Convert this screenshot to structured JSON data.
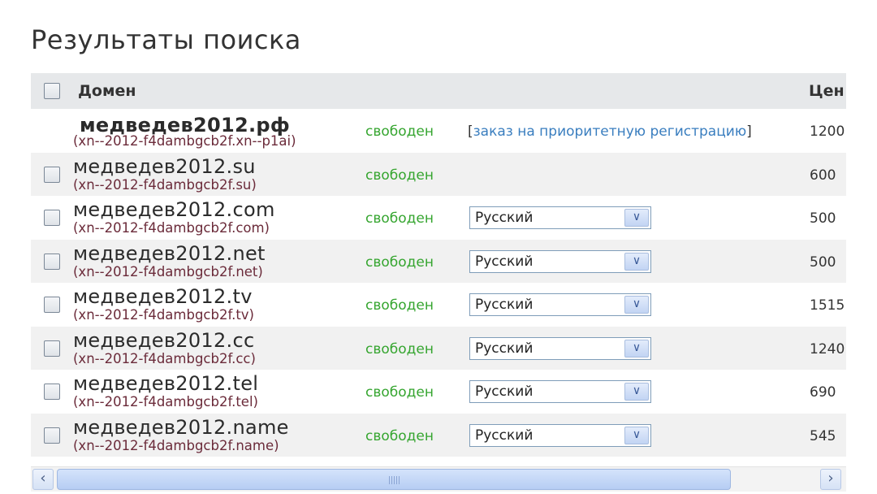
{
  "page": {
    "title": "Результаты поиска"
  },
  "table": {
    "headers": {
      "domain": "Домен",
      "price": "Цен"
    },
    "rows": [
      {
        "domain": "медведев2012.рф",
        "punycode": "(xn--2012-f4dambgcb2f.xn--p1ai)",
        "status": "свободен",
        "priority": {
          "open": "[",
          "link": "заказ на приоритетную регистрацию",
          "close": "]"
        },
        "price": "1200",
        "has_checkbox": false
      },
      {
        "domain": "медведев2012.su",
        "punycode": "(xn--2012-f4dambgcb2f.su)",
        "status": "свободен",
        "price": "600",
        "has_checkbox": true
      },
      {
        "domain": "медведев2012.com",
        "punycode": "(xn--2012-f4dambgcb2f.com)",
        "status": "свободен",
        "language": "Русский",
        "price": "500",
        "has_checkbox": true
      },
      {
        "domain": "медведев2012.net",
        "punycode": "(xn--2012-f4dambgcb2f.net)",
        "status": "свободен",
        "language": "Русский",
        "price": "500",
        "has_checkbox": true
      },
      {
        "domain": "медведев2012.tv",
        "punycode": "(xn--2012-f4dambgcb2f.tv)",
        "status": "свободен",
        "language": "Русский",
        "price": "1515",
        "has_checkbox": true
      },
      {
        "domain": "медведев2012.cc",
        "punycode": "(xn--2012-f4dambgcb2f.cc)",
        "status": "свободен",
        "language": "Русский",
        "price": "1240",
        "has_checkbox": true
      },
      {
        "domain": "медведев2012.tel",
        "punycode": "(xn--2012-f4dambgcb2f.tel)",
        "status": "свободен",
        "language": "Русский",
        "price": "690",
        "has_checkbox": true
      },
      {
        "domain": "медведев2012.name",
        "punycode": "(xn--2012-f4dambgcb2f.name)",
        "status": "свободен",
        "language": "Русский",
        "price": "545",
        "has_checkbox": true
      }
    ]
  },
  "icons": {
    "dropdown": "chevron-down-icon",
    "scroll_left": "chevron-left-icon",
    "scroll_right": "chevron-right-icon"
  },
  "colors": {
    "status_free": "#35a52f",
    "link": "#3a7ebf",
    "punycode": "#6b2b3a",
    "header_bg": "#e6e8ea",
    "alt_row_bg": "#f1f1f1"
  }
}
